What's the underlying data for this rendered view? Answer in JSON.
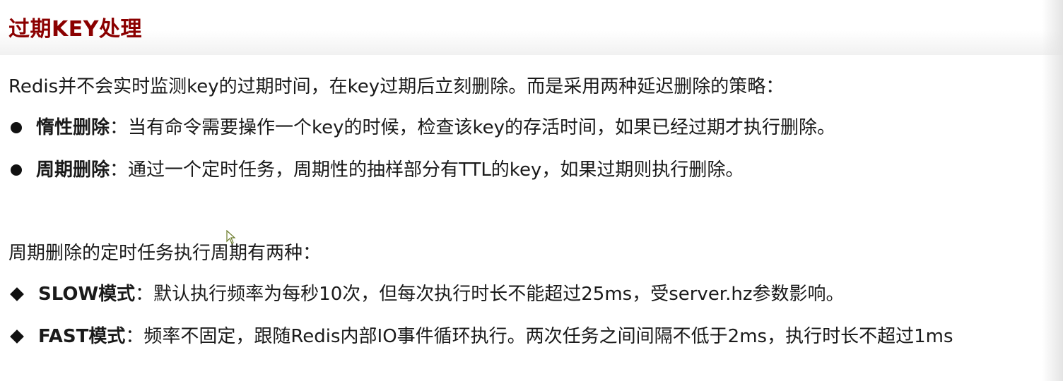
{
  "title": "过期KEY处理",
  "intro": "Redis并不会实时监测key的过期时间，在key过期后立刻删除。而是采用两种延迟删除的策略：",
  "strategies": [
    {
      "term": "惰性删除",
      "desc": "：当有命令需要操作一个key的时候，检查该key的存活时间，如果已经过期才执行删除。"
    },
    {
      "term": "周期删除",
      "desc": "：通过一个定时任务，周期性的抽样部分有TTL的key，如果过期则执行删除。"
    }
  ],
  "periodic_intro": "周期删除的定时任务执行周期有两种：",
  "modes": [
    {
      "term": "SLOW模式",
      "desc": "：默认执行频率为每秒10次，但每次执行时长不能超过25ms，受server.hz参数影响。"
    },
    {
      "term": "FAST模式",
      "desc": "：频率不固定，跟随Redis内部IO事件循环执行。两次任务之间间隔不低于2ms，执行时长不超过1ms"
    }
  ],
  "colors": {
    "title": "#8b0000",
    "text": "#1a1a1a"
  }
}
